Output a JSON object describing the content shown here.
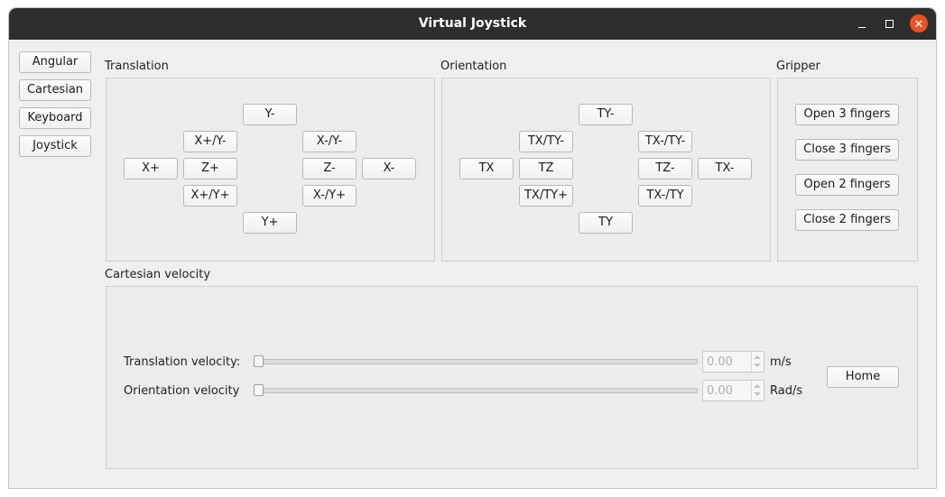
{
  "window": {
    "title": "Virtual Joystick",
    "controls": {
      "minimize_icon": "minimize-icon",
      "maximize_icon": "maximize-icon",
      "close_icon": "close-icon",
      "close_glyph": "✕"
    },
    "accent_color": "#e95420"
  },
  "mode_buttons": [
    "Angular",
    "Cartesian",
    "Keyboard",
    "Joystick"
  ],
  "translation": {
    "title": "Translation",
    "buttons": {
      "y_minus": "Y-",
      "xp_ym": "X+/Y-",
      "xm_ym": "X-/Y-",
      "x_plus": "X+",
      "z_plus": "Z+",
      "z_minus": "Z-",
      "x_minus": "X-",
      "xp_yp": "X+/Y+",
      "xm_yp": "X-/Y+",
      "y_plus": "Y+"
    }
  },
  "orientation": {
    "title": "Orientation",
    "buttons": {
      "ty_minus": "TY-",
      "tx_tym": "TX/TY-",
      "txm_tym": "TX-/TY-",
      "tx": "TX",
      "tz": "TZ",
      "tz_minus": "TZ-",
      "tx_minus": "TX-",
      "tx_typ": "TX/TY+",
      "txm_ty": "TX-/TY",
      "ty": "TY"
    }
  },
  "gripper": {
    "title": "Gripper",
    "buttons": [
      "Open 3 fingers",
      "Close 3 fingers",
      "Open 2 fingers",
      "Close 2 fingers"
    ]
  },
  "velocity": {
    "title": "Cartesian velocity",
    "translation_label": "Translation velocity:",
    "translation_value": "0.00",
    "translation_unit": "m/s",
    "translation_slider_fraction": 0,
    "orientation_label": "Orientation velocity",
    "orientation_value": "0.00",
    "orientation_unit": "Rad/s",
    "orientation_slider_fraction": 0,
    "home_label": "Home"
  }
}
